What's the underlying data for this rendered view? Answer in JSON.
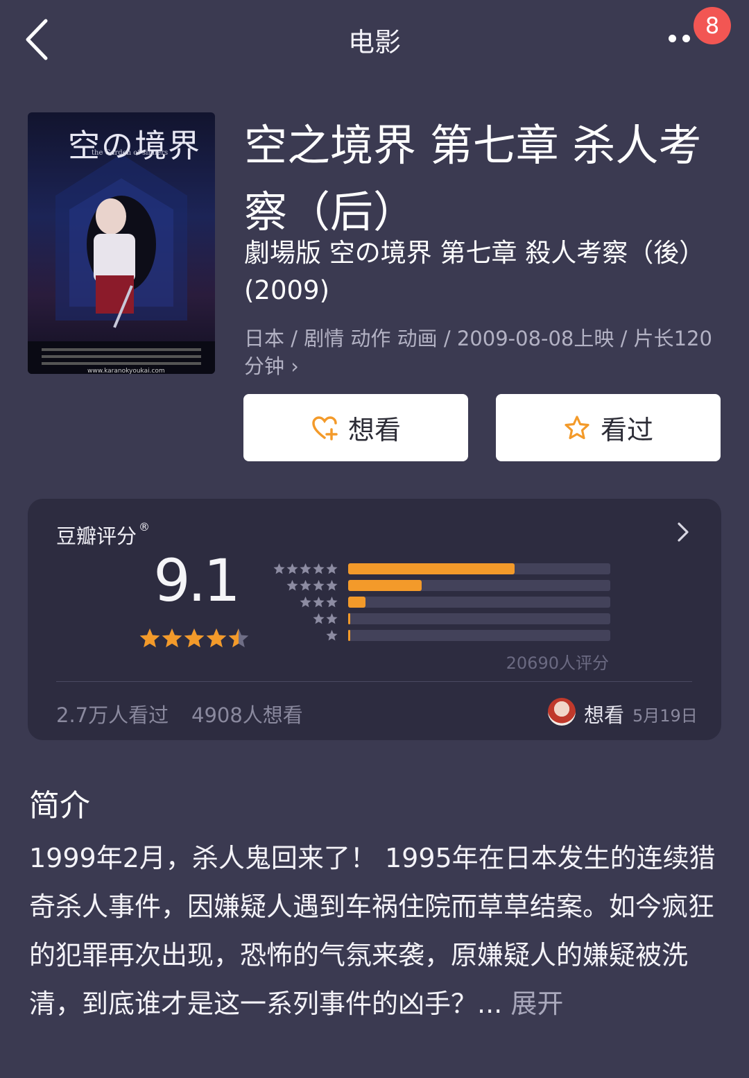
{
  "header": {
    "title": "电影",
    "badge_count": "8"
  },
  "poster": {
    "title_art": "空の境界",
    "subtitle_art": "the Garden of sinners",
    "url_text": "www.karanokyoukai.com"
  },
  "movie": {
    "title": "空之境界 第七章 杀人考察（后）",
    "original_title": "劇場版 空の境界 第七章 殺人考察（後）(2009)",
    "meta": "日本 / 剧情 动作 动画 / 2009-08-08上映 / 片长120分钟 ›"
  },
  "actions": {
    "want_label": "想看",
    "watched_label": "看过"
  },
  "rating": {
    "label": "豆瓣评分",
    "registered": "®",
    "score": "9.1",
    "stars_value": 4.5,
    "distribution": [
      {
        "stars": 5,
        "fraction": 0.635
      },
      {
        "stars": 4,
        "fraction": 0.28
      },
      {
        "stars": 3,
        "fraction": 0.065
      },
      {
        "stars": 2,
        "fraction": 0.006
      },
      {
        "stars": 1,
        "fraction": 0.006
      }
    ],
    "votes": "20690人评分",
    "watched_count": "2.7万人看过",
    "wish_count": "4908人想看",
    "my_status": "想看",
    "my_date": "5月19日"
  },
  "synopsis": {
    "title": "简介",
    "text": "1999年2月，杀人鬼回来了！ 1995年在日本发生的连续猎奇杀人事件，因嫌疑人遇到车祸住院而草草结案。如今疯狂的犯罪再次出现，恐怖的气氛来袭，原嫌疑人的嫌疑被洗清，到底谁才是这一系列事件的凶手？... ",
    "expand_label": "展开"
  },
  "colors": {
    "background": "#3b3a51",
    "card": "#2d2c40",
    "accent_orange": "#f39a2a",
    "badge_red": "#f25653"
  }
}
